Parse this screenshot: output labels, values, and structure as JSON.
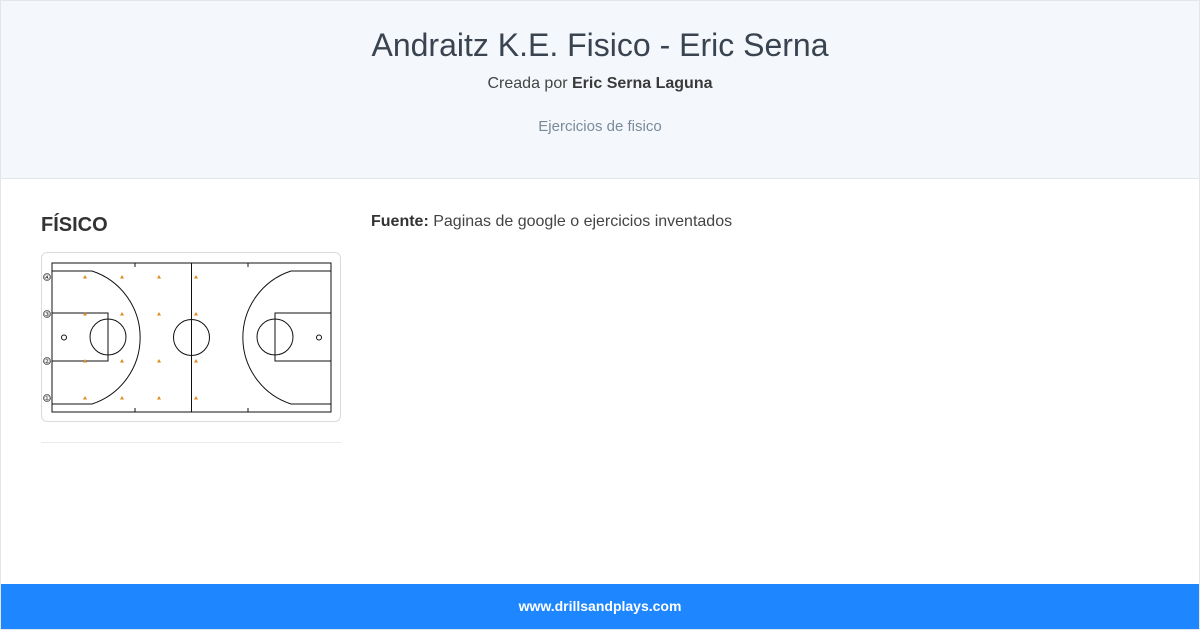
{
  "header": {
    "title": "Andraitz K.E. Fisico - Eric Serna",
    "author_prefix": "Creada por ",
    "author_name": "Eric Serna Laguna",
    "subtitle": "Ejercicios de fisico"
  },
  "section": {
    "title": "FÍSICO",
    "diagram": {
      "lane_markers": [
        "④",
        "③",
        "②",
        "①"
      ],
      "cone_color": "#e08a1e"
    }
  },
  "source": {
    "label": "Fuente:",
    "text": " Paginas de google o ejercicios inventados"
  },
  "footer": {
    "link_text": "www.drillsandplays.com",
    "color": "#1e87ff"
  }
}
